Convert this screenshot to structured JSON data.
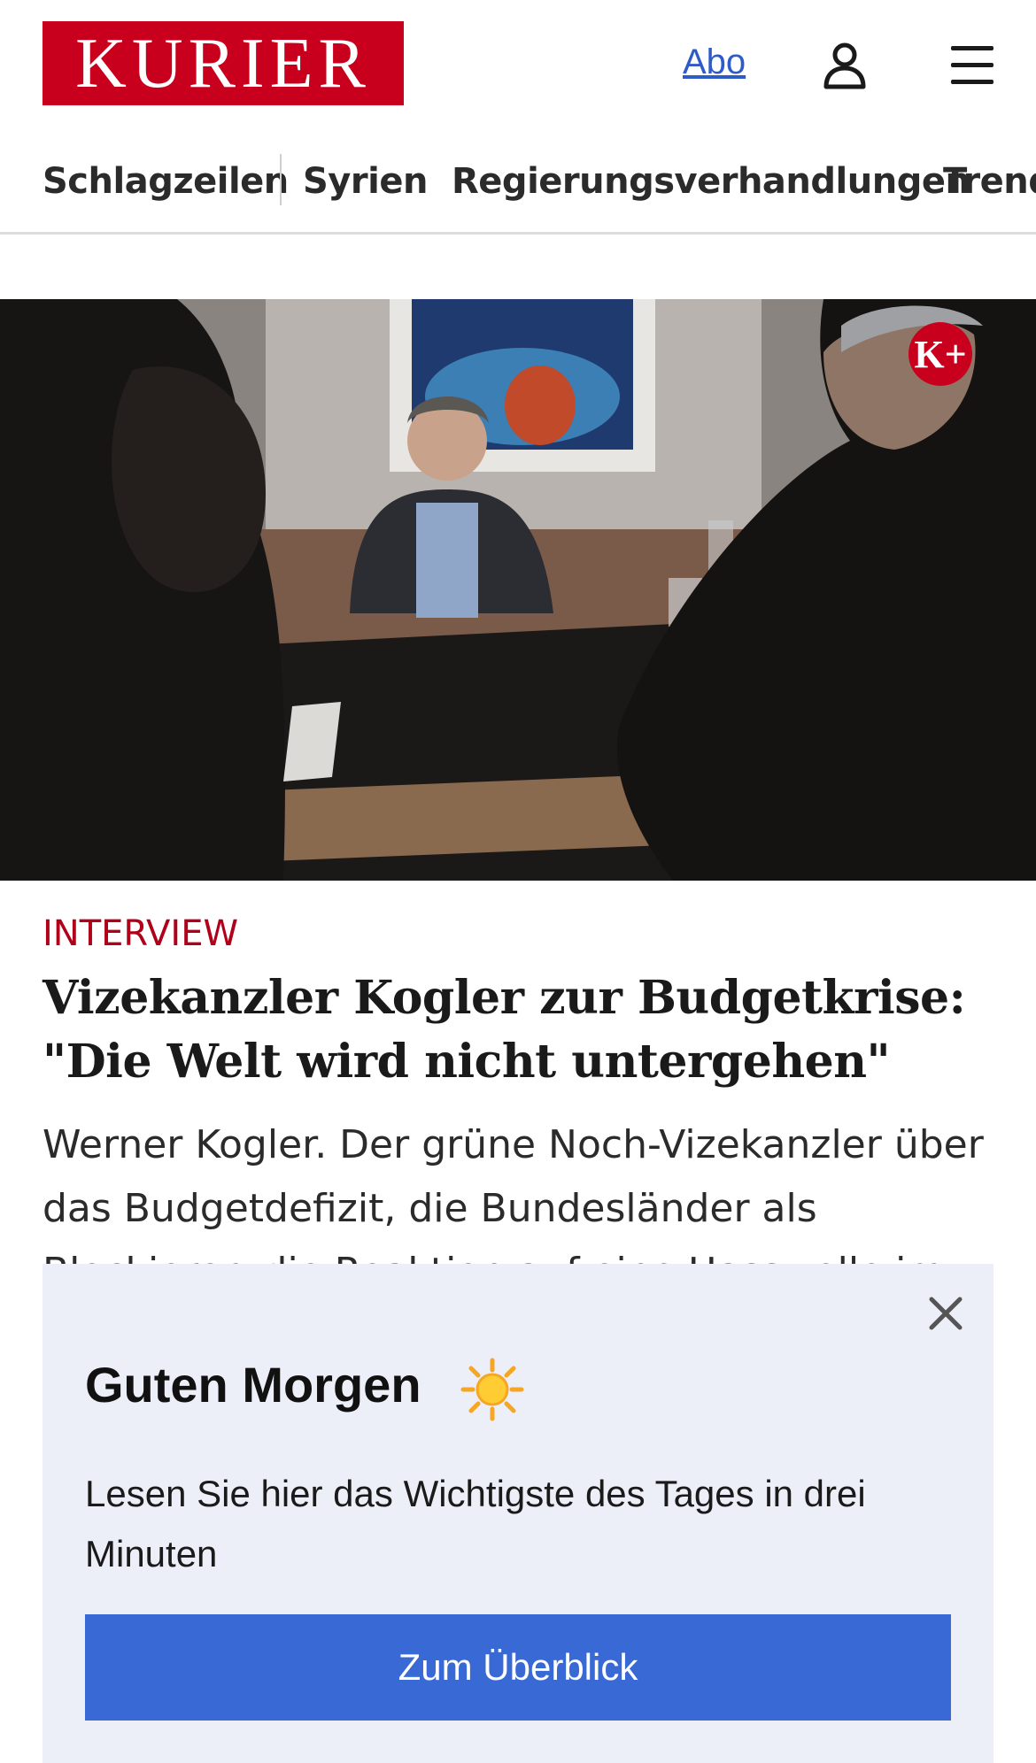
{
  "header": {
    "logo_text": "KURIER",
    "abo_label": "Abo",
    "user_icon": "user-icon",
    "menu_icon": "menu-icon"
  },
  "nav": {
    "items": [
      "Schlagzeilen",
      "Syrien",
      "Regierungsverhandlungen",
      "Trends"
    ]
  },
  "hero": {
    "badge_text": "K+"
  },
  "article": {
    "kicker": "INTERVIEW",
    "headline": "Vizekanzler Kogler zur Budgetkrise: \"Die Welt wird nicht untergehen\"",
    "teaser": "Werner Kogler. Der grüne Noch-Vizekanzler über das Budgetdefizit, die Bundesländer als Blockierer, die Reaktion auf eine Hasswelle im Netz und über"
  },
  "popup": {
    "title": "Guten Morgen",
    "icon": "sun-icon",
    "text": "Lesen Sie hier das Wichtigste des Tages in drei Minuten",
    "cta_label": "Zum Überblick",
    "close_icon": "close-icon"
  },
  "colors": {
    "brand_red": "#c8001e",
    "link_blue": "#2e5bc8",
    "cta_blue": "#3869d4",
    "popup_bg": "#eceef8"
  }
}
